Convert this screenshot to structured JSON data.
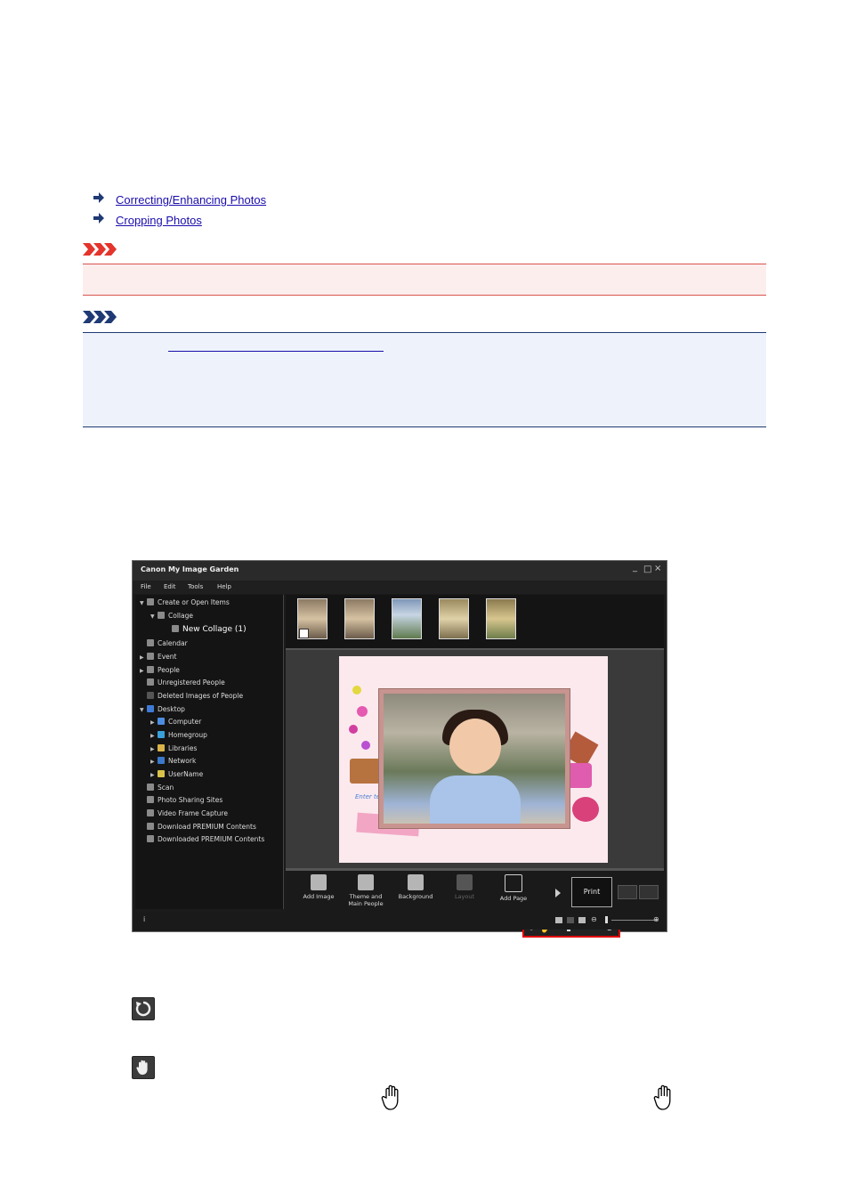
{
  "links": [
    {
      "text": "Correcting/Enhancing Photos"
    },
    {
      "text": "Cropping Photos"
    }
  ],
  "app": {
    "title": "Canon My Image Garden",
    "window_buttons": {
      "minimize": "_",
      "maximize": "□",
      "close": "×"
    },
    "menu": [
      "File",
      "Edit",
      "Tools",
      "Help"
    ],
    "tree": [
      {
        "label": "Create or Open Items",
        "expand": "▼"
      },
      {
        "label": "Collage",
        "expand": "▼"
      },
      {
        "label": "New Collage (1)",
        "expand": ""
      },
      {
        "label": "Calendar",
        "expand": ""
      },
      {
        "label": "Event",
        "expand": "▶"
      },
      {
        "label": "People",
        "expand": "▶"
      },
      {
        "label": "Unregistered People",
        "expand": ""
      },
      {
        "label": "Deleted Images of People",
        "expand": ""
      },
      {
        "label": "Desktop",
        "expand": "▼"
      },
      {
        "label": "Computer",
        "expand": "▶"
      },
      {
        "label": "Homegroup",
        "expand": "▶"
      },
      {
        "label": "Libraries",
        "expand": "▶"
      },
      {
        "label": "Network",
        "expand": "▶"
      },
      {
        "label": "UserName",
        "expand": "▶"
      },
      {
        "label": "Scan",
        "expand": ""
      },
      {
        "label": "Photo Sharing Sites",
        "expand": ""
      },
      {
        "label": "Video Frame Capture",
        "expand": ""
      },
      {
        "label": "Download PREMIUM Contents",
        "expand": ""
      },
      {
        "label": "Downloaded PREMIUM Contents",
        "expand": ""
      }
    ],
    "page_text": "Enter tex",
    "toolbar": {
      "add_image": "Add Image",
      "theme_line1": "Theme and",
      "theme_line2": "Main People",
      "background": "Background",
      "layout": "Layout",
      "add_page": "Add Page",
      "print": "Print"
    },
    "status": {
      "info": "i",
      "zoom_out": "⊖",
      "zoom_in": "⊕"
    },
    "ctrl": {
      "rotate": "⟳",
      "hand": "✋",
      "zoom": "⊕"
    }
  },
  "colors": {
    "highlight": "#e00000",
    "link": "#1a0dab",
    "important": "#d9534f",
    "note": "#1f3a75"
  }
}
